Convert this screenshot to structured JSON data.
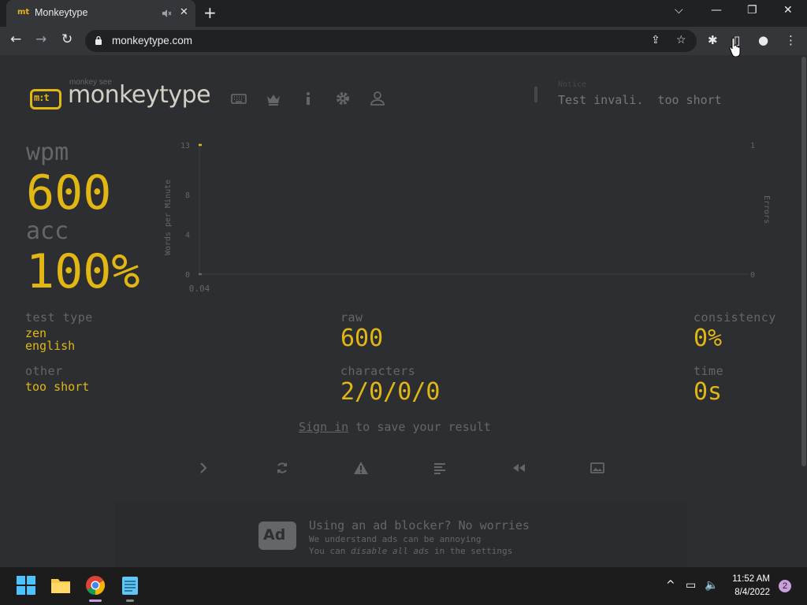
{
  "browser": {
    "tab_title": "Monkeytype",
    "tab_favicon": "mt",
    "close_glyph": "✕",
    "new_tab_glyph": "+",
    "url": "monkeytype.com",
    "window_controls": {
      "dropdown": "⌵",
      "minimize": "—",
      "restore": "❐",
      "close": "✕"
    },
    "nav": {
      "back": "←",
      "forward": "→",
      "reload": "↻"
    },
    "toolbar_glyphs": {
      "share": "⇪",
      "star": "☆",
      "extensions": "✱",
      "sidepanel": "▯",
      "profile": "●",
      "menu": "⋮"
    }
  },
  "header": {
    "logo_sub": "monkey see",
    "logo_box": "m:t",
    "logo_text": "monkeytype",
    "nav_icons": [
      "keyboard-icon",
      "crown-icon",
      "info-icon",
      "gear-icon",
      "user-icon"
    ]
  },
  "notification": {
    "header": "Notice",
    "text": "Test invali.  too short"
  },
  "result": {
    "wpm_label": "wpm",
    "wpm_value": "600",
    "acc_label": "acc",
    "acc_value": "100%",
    "test_type_label": "test type",
    "test_type_mode": "zen",
    "test_type_language": "english",
    "other_label": "other",
    "other_value": "too short",
    "raw_label": "raw",
    "raw_value": "600",
    "characters_label": "characters",
    "characters_value": "2/0/0/0",
    "consistency_label": "consistency",
    "consistency_value": "0%",
    "time_label": "time",
    "time_value": "0s"
  },
  "signin": {
    "link": "Sign in",
    "rest": " to save your result"
  },
  "actions": [
    "next-test-icon",
    "restart-icon",
    "report-icon",
    "words-history-icon",
    "replay-icon",
    "screenshot-icon"
  ],
  "ad": {
    "badge": "Ad",
    "title": "Using an ad blocker? No worries",
    "line1": "We understand ads can be annoying",
    "line2_a": "You can ",
    "line2_em": "disable all ads",
    "line2_b": " in the settings"
  },
  "taskbar": {
    "apps": [
      "start-icon",
      "file-explorer-icon",
      "chrome-icon",
      "notepad-icon"
    ],
    "time": "11:52 AM",
    "date": "8/4/2022",
    "notification_count": "2",
    "tray_glyphs": {
      "chevron": "^",
      "network": "▭",
      "volume": "🔈"
    }
  },
  "colors": {
    "bg": "#2c2e31",
    "main": "#e2b714",
    "sub": "#646669",
    "text": "#d1d0c5"
  },
  "chart_data": {
    "type": "line",
    "x": [
      0.04
    ],
    "series": [
      {
        "values": [
          13
        ],
        "color": "#e2b714"
      },
      {
        "values": [
          0
        ],
        "color": "#646669"
      }
    ],
    "xlabel": "",
    "ylabel": "Words per Minute",
    "y2label": "Errors",
    "yticks": [
      0,
      4,
      8,
      13
    ],
    "y2ticks": [
      0,
      1
    ],
    "xticks": [
      "0.04"
    ],
    "ylim": [
      0,
      13
    ],
    "y2lim": [
      0,
      1
    ]
  }
}
